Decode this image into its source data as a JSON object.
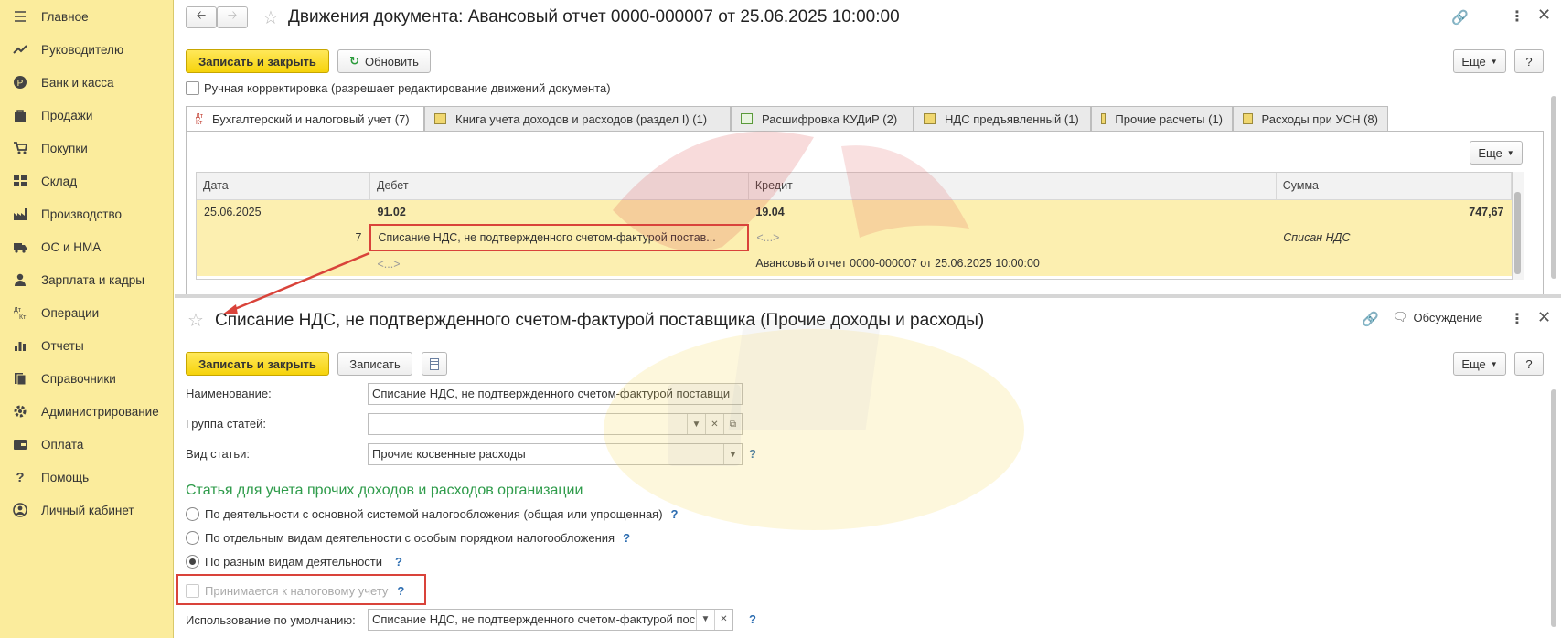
{
  "sidebar": {
    "items": [
      {
        "label": "Главное",
        "icon": "menu-icon"
      },
      {
        "label": "Руководителю",
        "icon": "trend-icon"
      },
      {
        "label": "Банк и касса",
        "icon": "coin-icon"
      },
      {
        "label": "Продажи",
        "icon": "bag-icon"
      },
      {
        "label": "Покупки",
        "icon": "cart-icon"
      },
      {
        "label": "Склад",
        "icon": "warehouse-icon"
      },
      {
        "label": "Производство",
        "icon": "factory-icon"
      },
      {
        "label": "ОС и НМА",
        "icon": "truck-icon"
      },
      {
        "label": "Зарплата и кадры",
        "icon": "person-icon"
      },
      {
        "label": "Операции",
        "icon": "dt-kt-icon"
      },
      {
        "label": "Отчеты",
        "icon": "bar-chart-icon"
      },
      {
        "label": "Справочники",
        "icon": "books-icon"
      },
      {
        "label": "Администрирование",
        "icon": "gear-icon"
      },
      {
        "label": "Оплата",
        "icon": "wallet-icon"
      },
      {
        "label": "Помощь",
        "icon": "question-icon"
      },
      {
        "label": "Личный кабинет",
        "icon": "user-circle-icon"
      }
    ]
  },
  "top": {
    "title": "Движения документа: Авансовый отчет 0000-000007 от 25.06.2025 10:00:00",
    "save_close": "Записать и закрыть",
    "refresh": "Обновить",
    "more": "Еще",
    "help": "?",
    "manual_edit": "Ручная корректировка (разрешает редактирование движений документа)",
    "tabs": [
      {
        "label": "Бухгалтерский и налоговый учет (7)",
        "icon": "dt-kt-icon"
      },
      {
        "label": "Книга учета доходов и расходов (раздел I) (1)",
        "icon": "register-icon"
      },
      {
        "label": "Расшифровка КУДиР (2)",
        "icon": "table-icon"
      },
      {
        "label": "НДС предъявленный (1)",
        "icon": "register-icon"
      },
      {
        "label": "Прочие расчеты (1)",
        "icon": "register-icon"
      },
      {
        "label": "Расходы при УСН (8)",
        "icon": "register-icon"
      }
    ],
    "table_more": "Еще",
    "columns": {
      "date": "Дата",
      "debit": "Дебет",
      "credit": "Кредит",
      "sum": "Сумма"
    },
    "row": {
      "date": "25.06.2025",
      "debit_account": "91.02",
      "credit_account": "19.04",
      "sum": "747,67",
      "num": "7",
      "debit_subconto": "Списание НДС, не подтвержденного счетом-фактурой постав...",
      "credit_subconto1": "<...>",
      "comment": "Списан НДС",
      "debit_subconto2": "<...>",
      "credit_subconto2": "Авансовый отчет 0000-000007 от 25.06.2025 10:00:00"
    }
  },
  "bottom": {
    "title": "Списание НДС, не подтвержденного счетом-фактурой поставщика (Прочие доходы и расходы)",
    "discussion": "Обсуждение",
    "save_close": "Записать и закрыть",
    "save": "Записать",
    "more": "Еще",
    "help": "?",
    "name_label": "Наименование:",
    "name_value": "Списание НДС, не подтвержденного счетом-фактурой поставщи",
    "group_label": "Группа статей:",
    "group_value": "",
    "kind_label": "Вид статьи:",
    "kind_value": "Прочие косвенные расходы",
    "section_title": "Статья для учета прочих доходов и расходов организации",
    "radio1": "По деятельности с основной системой налогообложения (общая или упрощенная)",
    "radio2": "По отдельным видам деятельности с особым порядком налогообложения",
    "radio3": "По разным видам деятельности",
    "tax_accept": "Принимается к налоговому учету",
    "default_use_label": "Использование по умолчанию:",
    "default_use_value": "Списание НДС, не подтвержденного счетом-фактурой пос"
  },
  "colors": {
    "sidebar": "#fbec9c",
    "accent": "#f6d30b",
    "highlight": "#d9433a",
    "section": "#2e9b4a"
  }
}
